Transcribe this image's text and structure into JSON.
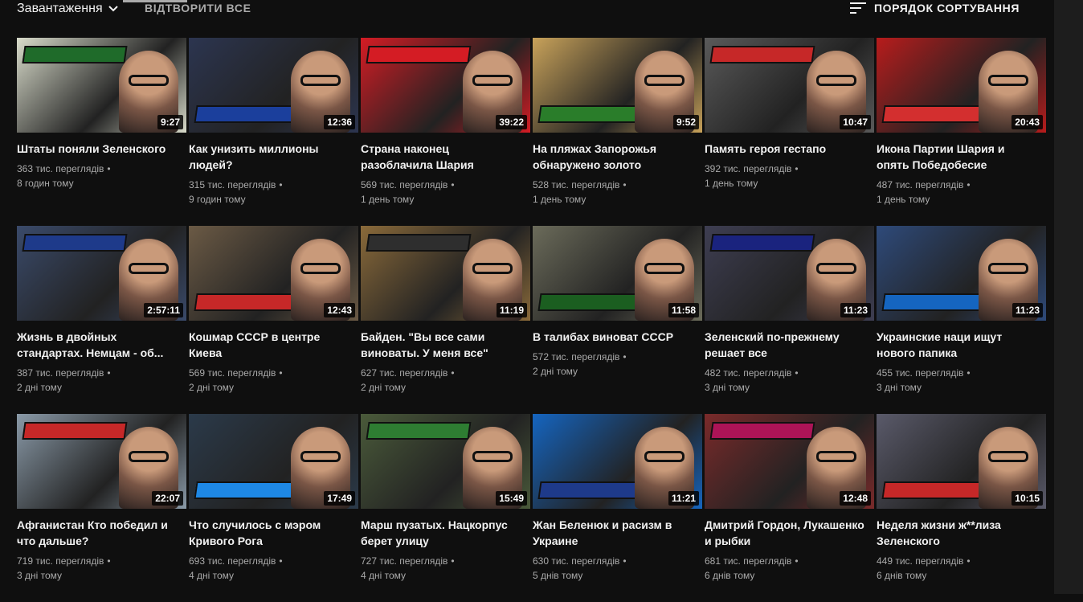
{
  "header": {
    "tab_label": "Завантаження",
    "play_all": "ВІДТВОРИТИ ВСЕ",
    "sort_label": "ПОРЯДОК СОРТУВАННЯ"
  },
  "videos": [
    {
      "title": "Штаты поняли Зеленского",
      "views": "363 тис. переглядів",
      "age": "8 годин тому",
      "duration": "9:27",
      "lines": 1,
      "accent": "#1f6b2a",
      "bg": "#d9dccb"
    },
    {
      "title": "Как унизить миллионы людей?",
      "views": "315 тис. переглядів",
      "age": "9 годин тому",
      "duration": "12:36",
      "lines": 2,
      "accent": "#1b3f9c",
      "bg": "#2c3550"
    },
    {
      "title": "Страна наконец разоблачила Шария",
      "views": "569 тис. переглядів",
      "age": "1 день тому",
      "duration": "39:22",
      "lines": 2,
      "accent": "#d41c24",
      "bg": "#d41c24"
    },
    {
      "title": "На пляжах Запорожья обнаружено золото",
      "views": "528 тис. переглядів",
      "age": "1 день тому",
      "duration": "9:52",
      "lines": 2,
      "accent": "#2a7d2a",
      "bg": "#c8a25a"
    },
    {
      "title": "Память героя гестапо",
      "views": "392 тис. переглядів",
      "age": "1 день тому",
      "duration": "10:47",
      "lines": 1,
      "accent": "#c62828",
      "bg": "#5a5a5a"
    },
    {
      "title": "Икона Партии Шария и опять Победобесие",
      "views": "487 тис. переглядів",
      "age": "1 день тому",
      "duration": "20:43",
      "lines": 2,
      "accent": "#d32f2f",
      "bg": "#b71c1c"
    },
    {
      "title": "Жизнь в двойных стандартах. Немцам - об...",
      "views": "387 тис. переглядів",
      "age": "2 дні тому",
      "duration": "2:57:11",
      "lines": 2,
      "accent": "#1e3a8a",
      "bg": "#3a4a6a"
    },
    {
      "title": "Кошмар СССР в центре Киева",
      "views": "569 тис. переглядів",
      "age": "2 дні тому",
      "duration": "12:43",
      "lines": 2,
      "accent": "#c62828",
      "bg": "#6b5a45"
    },
    {
      "title": "Байден. \"Вы все сами виноваты. У меня все\"",
      "views": "627 тис. переглядів",
      "age": "2 дні тому",
      "duration": "11:19",
      "lines": 2,
      "accent": "#2e2e2e",
      "bg": "#8a6a3a"
    },
    {
      "title": "В талибах виноват СССР",
      "views": "572 тис. переглядів",
      "age": "2 дні тому",
      "duration": "11:58",
      "lines": 1,
      "accent": "#1b5e20",
      "bg": "#6b6b5a"
    },
    {
      "title": "Зеленский по-прежнему решает все",
      "views": "482 тис. переглядів",
      "age": "3 дні тому",
      "duration": "11:23",
      "lines": 2,
      "accent": "#1a237e",
      "bg": "#3e3e52"
    },
    {
      "title": "Украинские наци ищут нового папика",
      "views": "455 тис. переглядів",
      "age": "3 дні тому",
      "duration": "11:23",
      "lines": 2,
      "accent": "#1565c0",
      "bg": "#2e4a7a"
    },
    {
      "title": "Афганистан Кто победил и что дальше?",
      "views": "719 тис. переглядів",
      "age": "3 дні тому",
      "duration": "22:07",
      "lines": 2,
      "accent": "#c62828",
      "bg": "#8a9aa8"
    },
    {
      "title": "Что случилось с мэром Кривого Рога",
      "views": "693 тис. переглядів",
      "age": "4 дні тому",
      "duration": "17:49",
      "lines": 2,
      "accent": "#1e88e5",
      "bg": "#2b3a4a"
    },
    {
      "title": "Марш пузатых. Нацкорпус берет улицу",
      "views": "727 тис. переглядів",
      "age": "4 дні тому",
      "duration": "15:49",
      "lines": 2,
      "accent": "#2e7d32",
      "bg": "#4a5a3a"
    },
    {
      "title": "Жан Беленюк и расизм в Украине",
      "views": "630 тис. переглядів",
      "age": "5 днів тому",
      "duration": "11:21",
      "lines": 2,
      "accent": "#1e3a8a",
      "bg": "#1565c0"
    },
    {
      "title": "Дмитрий Гордон, Лукашенко и рыбки",
      "views": "681 тис. переглядів",
      "age": "6 днів тому",
      "duration": "12:48",
      "lines": 2,
      "accent": "#ad1457",
      "bg": "#7a2a2a"
    },
    {
      "title": "Неделя жизни ж**лиза Зеленского",
      "views": "449 тис. переглядів",
      "age": "6 днів тому",
      "duration": "10:15",
      "lines": 2,
      "accent": "#c62828",
      "bg": "#5a5a6a"
    }
  ]
}
